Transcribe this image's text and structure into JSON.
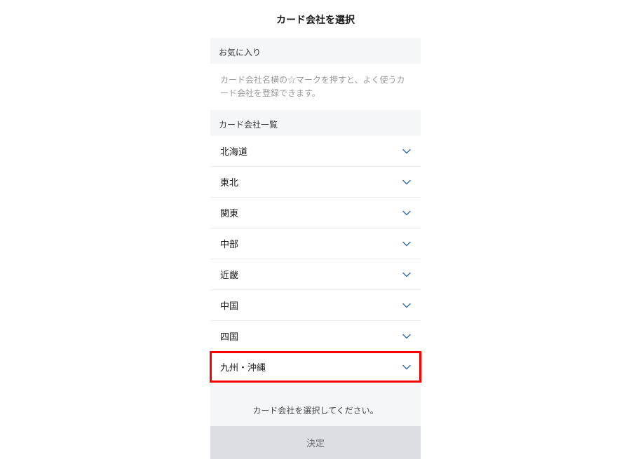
{
  "header": {
    "title": "カード会社を選択"
  },
  "favorites": {
    "section_label": "お気に入り",
    "message": "カード会社名横の☆マークを押すと、よく使うカード会社を登録できます。"
  },
  "company_list": {
    "section_label": "カード会社一覧",
    "items": [
      {
        "label": "北海道"
      },
      {
        "label": "東北"
      },
      {
        "label": "関東"
      },
      {
        "label": "中部"
      },
      {
        "label": "近畿"
      },
      {
        "label": "中国"
      },
      {
        "label": "四国"
      },
      {
        "label": "九州・沖縄"
      }
    ],
    "highlighted_index": 7
  },
  "footer": {
    "message": "カード会社を選択してください。",
    "confirm_label": "決定"
  },
  "colors": {
    "highlight": "#ff0000",
    "chevron": "#3a6fb8"
  }
}
